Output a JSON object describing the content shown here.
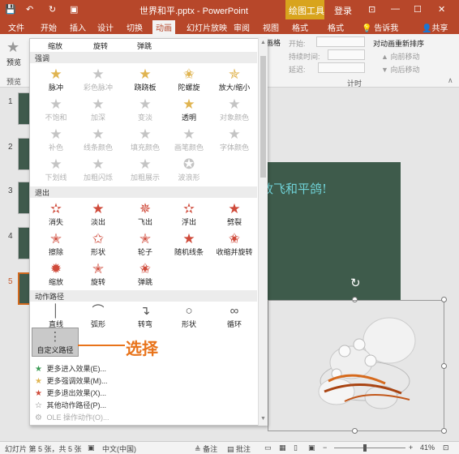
{
  "titlebar": {
    "doc_title": "世界和平.pptx - PowerPoint",
    "context_tools": "绘图工具",
    "sign_in": "登录"
  },
  "tabs": [
    "文件",
    "开始",
    "插入",
    "设计",
    "切换",
    "动画",
    "幻灯片放映",
    "审阅",
    "视图",
    "格式",
    "格式"
  ],
  "tell_me": "告诉我",
  "share": "共享",
  "ribbon": {
    "preview_label": "预览",
    "preview_group": "预览",
    "start_label": "开始:",
    "duration_label": "持续时间:",
    "delay_label": "延迟:",
    "reorder_title": "对动画重新排序",
    "move_earlier": "向前移动",
    "move_later": "向后移动",
    "timing_group": "计时",
    "trigger_partial": "画格"
  },
  "gallery": {
    "top_row": [
      "缩放",
      "旋转",
      "弹跳"
    ],
    "emphasis_header": "强调",
    "emphasis": [
      "脉冲",
      "彩色脉冲",
      "跷跷板",
      "陀螺旋",
      "放大/缩小",
      "不饱和",
      "加深",
      "变淡",
      "透明",
      "对象颜色",
      "补色",
      "线条颜色",
      "填充颜色",
      "画笔颜色",
      "字体颜色",
      "下划线",
      "加粗闪烁",
      "加粗展示",
      "波浪形"
    ],
    "exit_header": "退出",
    "exit": [
      "消失",
      "淡出",
      "飞出",
      "浮出",
      "劈裂",
      "擦除",
      "形状",
      "轮子",
      "随机线条",
      "收缩并旋转",
      "缩放",
      "旋转",
      "弹跳"
    ],
    "paths_header": "动作路径",
    "paths": [
      "直线",
      "弧形",
      "转弯",
      "形状",
      "循环",
      "自定义路径"
    ],
    "more": [
      "更多进入效果(E)...",
      "更多强调效果(M)...",
      "更多退出效果(X)...",
      "其他动作路径(P)...",
      "OLE 操作动作(O)..."
    ]
  },
  "slide_title": "放飞和平鸽!",
  "slide_numbers": [
    "1",
    "2",
    "3",
    "4",
    "5"
  ],
  "callout": "选择",
  "status": {
    "slide_info": "幻灯片 第 5 张，共 5 张",
    "language": "中文(中国)",
    "notes": "备注",
    "comments": "批注",
    "zoom": "41%"
  }
}
